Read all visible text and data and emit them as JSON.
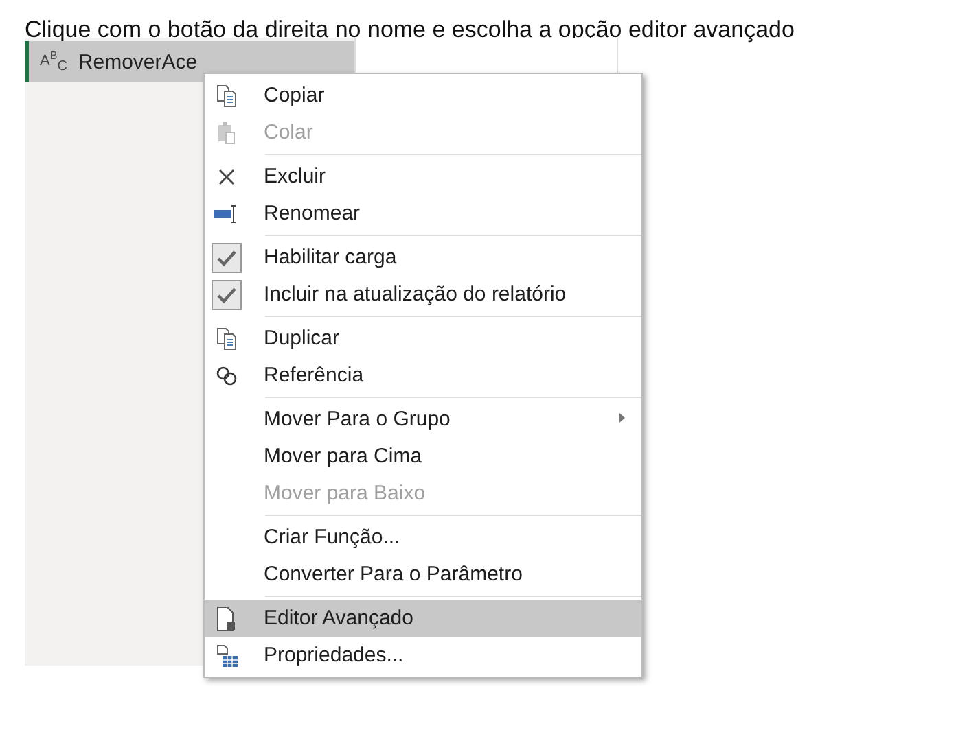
{
  "instruction": "Clique com o botão da direita no nome e escolha a opção editor avançado",
  "query": {
    "type_icon": "A$^{B}$$_{C}$",
    "name": "RemoverAce",
    "selected": true
  },
  "menu": {
    "groups": [
      {
        "items": [
          {
            "label": "Copiar",
            "kind": "copy",
            "disabled": false,
            "selected": false
          },
          {
            "label": "Colar",
            "kind": "paste",
            "disabled": true,
            "selected": false
          }
        ]
      },
      {
        "items": [
          {
            "label": "Excluir",
            "kind": "delete",
            "disabled": false,
            "selected": false
          },
          {
            "label": "Renomear",
            "kind": "rename",
            "disabled": false,
            "selected": false
          }
        ]
      },
      {
        "items": [
          {
            "label": "Habilitar carga",
            "kind": "check",
            "checked": true,
            "disabled": false,
            "selected": false
          },
          {
            "label": "Incluir na atualização do relatório",
            "kind": "check",
            "checked": true,
            "disabled": false,
            "selected": false
          }
        ]
      },
      {
        "items": [
          {
            "label": "Duplicar",
            "kind": "copy",
            "disabled": false,
            "selected": false
          },
          {
            "label": "Referência",
            "kind": "link",
            "disabled": false,
            "selected": false
          }
        ]
      },
      {
        "items": [
          {
            "label": "Mover Para o Grupo",
            "kind": "plain",
            "submenu": true,
            "disabled": false,
            "selected": false
          },
          {
            "label": "Mover para Cima",
            "kind": "plain",
            "disabled": false,
            "selected": false
          },
          {
            "label": "Mover para Baixo",
            "kind": "plain",
            "disabled": true,
            "selected": false
          }
        ]
      },
      {
        "items": [
          {
            "label": "Criar Função...",
            "kind": "plain",
            "disabled": false,
            "selected": false
          },
          {
            "label": "Converter Para o Parâmetro",
            "kind": "plain",
            "disabled": false,
            "selected": false
          }
        ]
      },
      {
        "items": [
          {
            "label": "Editor Avançado",
            "kind": "document",
            "disabled": false,
            "selected": true
          },
          {
            "label": "Propriedades...",
            "kind": "properties",
            "disabled": false,
            "selected": false
          }
        ]
      }
    ]
  }
}
